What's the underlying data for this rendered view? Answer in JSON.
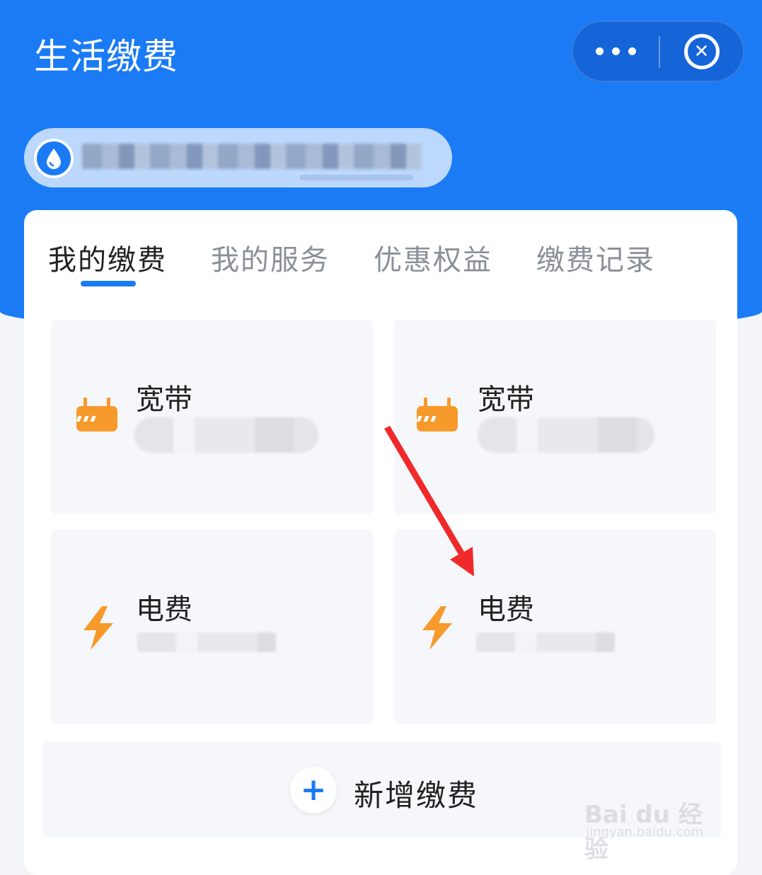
{
  "header": {
    "title": "生活缴费",
    "accent_color": "#1a7bf5"
  },
  "tabs": [
    {
      "label": "我的缴费",
      "active": true
    },
    {
      "label": "我的服务",
      "active": false
    },
    {
      "label": "优惠权益",
      "active": false
    },
    {
      "label": "缴费记录",
      "active": false
    }
  ],
  "cards": [
    {
      "label": "宽带",
      "icon": "router-icon"
    },
    {
      "label": "宽带",
      "icon": "router-icon"
    },
    {
      "label": "电费",
      "icon": "lightning-icon"
    },
    {
      "label": "电费",
      "icon": "lightning-icon"
    }
  ],
  "add_button": {
    "label": "新增缴费",
    "icon": "plus-icon"
  },
  "watermark": {
    "big": "Bai du 经验",
    "small": "jingyan.baidu.com"
  }
}
